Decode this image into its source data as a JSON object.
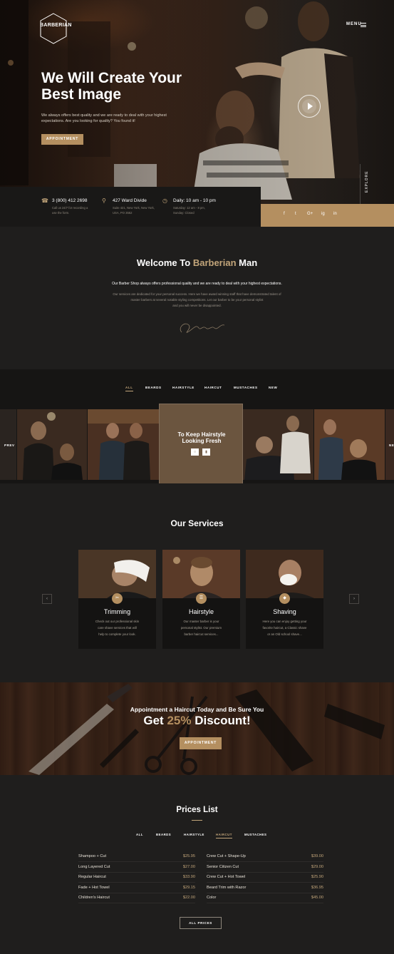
{
  "brand": {
    "logo_text": "BARBERIAN",
    "colors": {
      "accent": "#b48f60",
      "accent_text": "#c2a57a",
      "background": "#1f1e1d"
    }
  },
  "header": {
    "menu_label": "MENU",
    "menu_icon": "hamburger-icon"
  },
  "hero": {
    "title_line1": "We Will Create Your",
    "title_line2": "Best Image",
    "text_line1": "We always offers best quality and we are ready to deal with your highest",
    "text_line2": "expectations. Are you looking for quality? You found it!",
    "button_label": "APPOINTMENT",
    "play_icon": "play-icon",
    "explore_label": "EXPLORE"
  },
  "contact": {
    "phone": {
      "icon": "phone-icon",
      "title": "3 (800) 412 2698",
      "line1": "Call us 24/7 for recording a",
      "line2": "use the form."
    },
    "address": {
      "icon": "location-pin-icon",
      "title": "427 Ward Divide",
      "line1": "Suite 421, New York, New York,",
      "line2": "USA, PO 3562"
    },
    "hours": {
      "icon": "clock-icon",
      "title": "Daily: 10 am - 10 pm",
      "line1": "Saturday: 12 am - 8 pm,",
      "line2": "Sunday: Closed"
    }
  },
  "social": [
    "f",
    "t",
    "G+",
    "ig",
    "in"
  ],
  "welcome": {
    "title_pre": "Welcome To",
    "title_accent": "Barberian",
    "title_post": "Man",
    "lead": "Our Barber Shop always offers professional quality and we are ready to deal with your highest expectations.",
    "body_line1": "Our services are dedicated for your personal success. Here we have award winning staff that have demonstrated talent of",
    "body_line2": "master barbers at several notable styling competitions. Let our barber to be your personal stylist",
    "body_line3": "and you will never be disappointed."
  },
  "gallery": {
    "tabs": [
      "ALL",
      "BEARDS",
      "HAIRSTYLE",
      "HAIRCUT",
      "MUSTACHES",
      "NEW"
    ],
    "active_tab": "ALL",
    "prev_label": "PREV",
    "next_label": "NE",
    "feature_line1": "To Keep Hairstyle",
    "feature_line2": "Looking Fresh",
    "feature_icons": [
      "zoom-icon",
      "chair-icon"
    ]
  },
  "services": {
    "title": "Our Services",
    "items": [
      {
        "name": "Trimming",
        "icon": "scissors-icon",
        "desc1": "Check out our professional skin",
        "desc2": "care shave services that will",
        "desc3": "help to complete your look."
      },
      {
        "name": "Hairstyle",
        "icon": "comb-icon",
        "desc1": "Our master barber is your",
        "desc2": "personal stylist. Our premium",
        "desc3": "barber haircut services..."
      },
      {
        "name": "Shaving",
        "icon": "razor-icon",
        "desc1": "Here you can enjoy getting your",
        "desc2": "favorite haircut, a Classic shave",
        "desc3": "or an Old school shave..."
      }
    ],
    "prev_arrow": "‹",
    "next_arrow": "›"
  },
  "discount": {
    "line1": "Appointment a Haircut Today and Be Sure You",
    "line2_pre": "Get",
    "line2_accent": "25%",
    "line2_post": "Discount!",
    "button_label": "APPOINTMENT"
  },
  "prices": {
    "title": "Prices List",
    "tabs": [
      "ALL",
      "BEARDS",
      "HAIRSTYLE",
      "HAIRCUT",
      "MUSTACHES"
    ],
    "active_tab": "HAIRCUT",
    "left": [
      {
        "name": "Shampoo + Cut",
        "price": "$25.95"
      },
      {
        "name": "Long Layered Cut",
        "price": "$27.00"
      },
      {
        "name": "Regular Haircut",
        "price": "$33.90"
      },
      {
        "name": "Fade + Hot Towel",
        "price": "$29.15"
      },
      {
        "name": "Children's Haircut",
        "price": "$22.00"
      }
    ],
    "right": [
      {
        "name": "Crew Cut + Shape-Up",
        "price": "$39.00"
      },
      {
        "name": "Senior Citizen Cut",
        "price": "$29.00"
      },
      {
        "name": "Crew Cut + Hot Towel",
        "price": "$25.90"
      },
      {
        "name": "Beard Trim with Razor",
        "price": "$36.95"
      },
      {
        "name": "Color",
        "price": "$45.00"
      }
    ],
    "button_label": "ALL PRICES"
  }
}
